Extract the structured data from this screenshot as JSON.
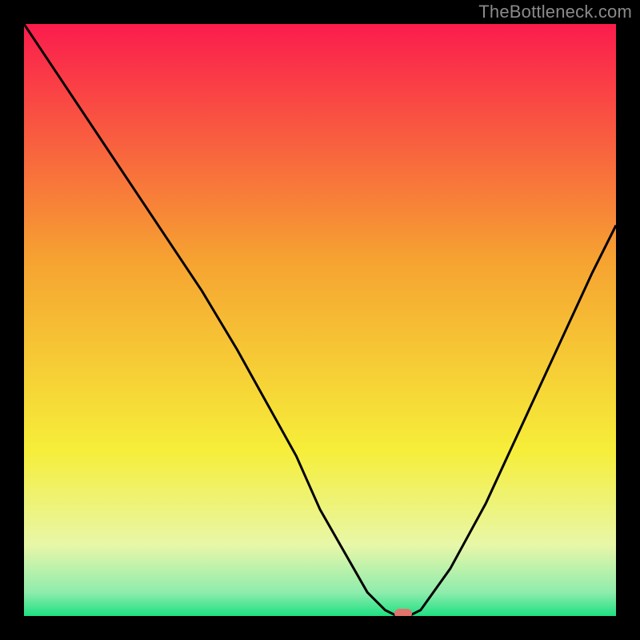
{
  "attribution": "TheBottleneck.com",
  "colors": {
    "black": "#000000",
    "line": "#000000",
    "marker": "#e2746d",
    "grad_top": "#fb1c4d",
    "grad_mid_orange": "#f6a331",
    "grad_yellow": "#f6ee39",
    "grad_pale": "#e8f7a8",
    "grad_green": "#1ee082"
  },
  "chart_data": {
    "type": "line",
    "title": "",
    "xlabel": "",
    "ylabel": "",
    "xlim": [
      0,
      100
    ],
    "ylim": [
      0,
      100
    ],
    "note": "V-shaped bottleneck curve over vertical rainbow gradient. x is horizontal position %, y is bottleneck % (0 at bottom = best / green, 100 at top = worst / red).",
    "series": [
      {
        "name": "bottleneck-curve",
        "x": [
          0,
          6,
          12,
          18,
          24,
          30,
          36,
          41,
          46,
          50,
          54,
          58,
          61,
          63,
          65,
          67,
          72,
          78,
          84,
          90,
          96,
          100
        ],
        "y": [
          100,
          91,
          82,
          73,
          64,
          55,
          45,
          36,
          27,
          18,
          11,
          4,
          1,
          0,
          0,
          1,
          8,
          19,
          32,
          45,
          58,
          66
        ]
      }
    ],
    "marker": {
      "x": 64,
      "y": 0.4,
      "label": "optimal-point"
    },
    "gradient_stops_pct": [
      {
        "p": 0,
        "c": "#fb1c4d"
      },
      {
        "p": 40,
        "c": "#f6a331"
      },
      {
        "p": 72,
        "c": "#f6ee39"
      },
      {
        "p": 88,
        "c": "#e8f7a8"
      },
      {
        "p": 96,
        "c": "#8fecad"
      },
      {
        "p": 100,
        "c": "#1ee082"
      }
    ]
  }
}
